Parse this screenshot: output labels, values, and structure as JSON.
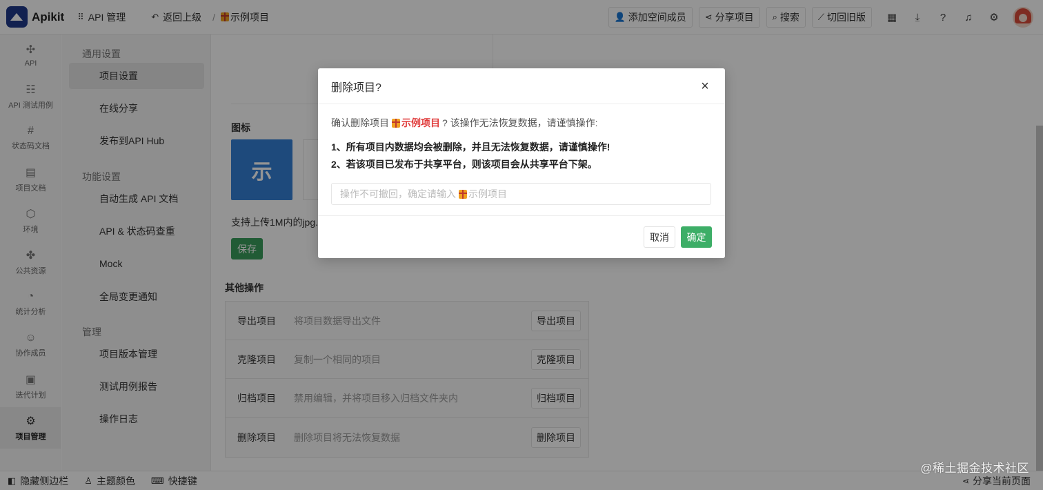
{
  "topbar": {
    "logo_text": "Apikit",
    "nav": [
      {
        "icon": "grid-icon",
        "label": "API 管理"
      },
      {
        "icon": "undo-icon",
        "label": "返回上级"
      }
    ],
    "breadcrumb_sep": "/",
    "project_name": "示例项目",
    "buttons": [
      {
        "icon": "add-user-icon",
        "label": "添加空间成员"
      },
      {
        "icon": "share-icon",
        "label": "分享项目"
      },
      {
        "icon": "search-icon",
        "label": "搜索"
      },
      {
        "icon": "magic-wand-icon",
        "label": "切回旧版"
      }
    ],
    "icons": [
      "calendar-icon",
      "download-icon",
      "help-icon",
      "bell-icon",
      "gear-icon"
    ]
  },
  "leftrail": {
    "items": [
      {
        "icon": "api-icon",
        "label": "API"
      },
      {
        "icon": "test-case-icon",
        "label": "API 测试用例"
      },
      {
        "icon": "status-code-icon",
        "label": "状态码文档"
      },
      {
        "icon": "doc-icon",
        "label": "项目文档"
      },
      {
        "icon": "environment-icon",
        "label": "环境"
      },
      {
        "icon": "puzzle-icon",
        "label": "公共资源"
      },
      {
        "icon": "pie-chart-icon",
        "label": "统计分析"
      },
      {
        "icon": "members-icon",
        "label": "协作成员"
      },
      {
        "icon": "calendar-check-icon",
        "label": "迭代计划"
      },
      {
        "icon": "gear-icon",
        "label": "项目管理",
        "active": true
      }
    ]
  },
  "subnav": {
    "groups": [
      {
        "title": "通用设置",
        "items": [
          "项目设置",
          "在线分享",
          "发布到API Hub"
        ]
      },
      {
        "title": "功能设置",
        "items": [
          "自动生成 API 文档",
          "API & 状态码查重",
          "Mock",
          "全局变更通知"
        ]
      },
      {
        "title": "管理",
        "items": [
          "项目版本管理",
          "测试用例报告",
          "操作日志"
        ]
      }
    ],
    "active": "项目设置"
  },
  "main": {
    "icon_section_title": "图标",
    "icon_char": "示",
    "upload_hint": "支持上传1M内的jpg.",
    "save_label": "保存",
    "other_ops_title": "其他操作",
    "ops": [
      {
        "name": "导出项目",
        "desc": "将项目数据导出文件",
        "button": "导出项目"
      },
      {
        "name": "克隆项目",
        "desc": "复制一个相同的项目",
        "button": "克隆项目"
      },
      {
        "name": "归档项目",
        "desc": "禁用编辑，并将项目移入归档文件夹内",
        "button": "归档项目"
      },
      {
        "name": "删除项目",
        "desc": "删除项目将无法恢复数据",
        "button": "删除项目"
      }
    ]
  },
  "footer": {
    "items": [
      {
        "icon": "sidebar-toggle-icon",
        "label": "隐藏侧边栏"
      },
      {
        "icon": "shirt-icon",
        "label": "主题颜色"
      },
      {
        "icon": "keyboard-icon",
        "label": "快捷键"
      }
    ],
    "share_page": "分享当前页面",
    "watermark": "@稀土掘金技术社区"
  },
  "modal": {
    "title": "删除项目?",
    "confirm_prefix": "确认删除项目",
    "project_name": "示例项目",
    "confirm_suffix": "? 该操作无法恢复数据，请谨慎操作:",
    "warning_1": "1、所有项目内数据均会被删除，并且无法恢复数据，请谨慎操作!",
    "warning_2": "2、若该项目已发布于共享平台，则该项目会从共享平台下架。",
    "input_placeholder_prefix": "操作不可撤回，确定请输入",
    "input_placeholder_name": "示例项目",
    "cancel_label": "取消",
    "ok_label": "确定"
  }
}
